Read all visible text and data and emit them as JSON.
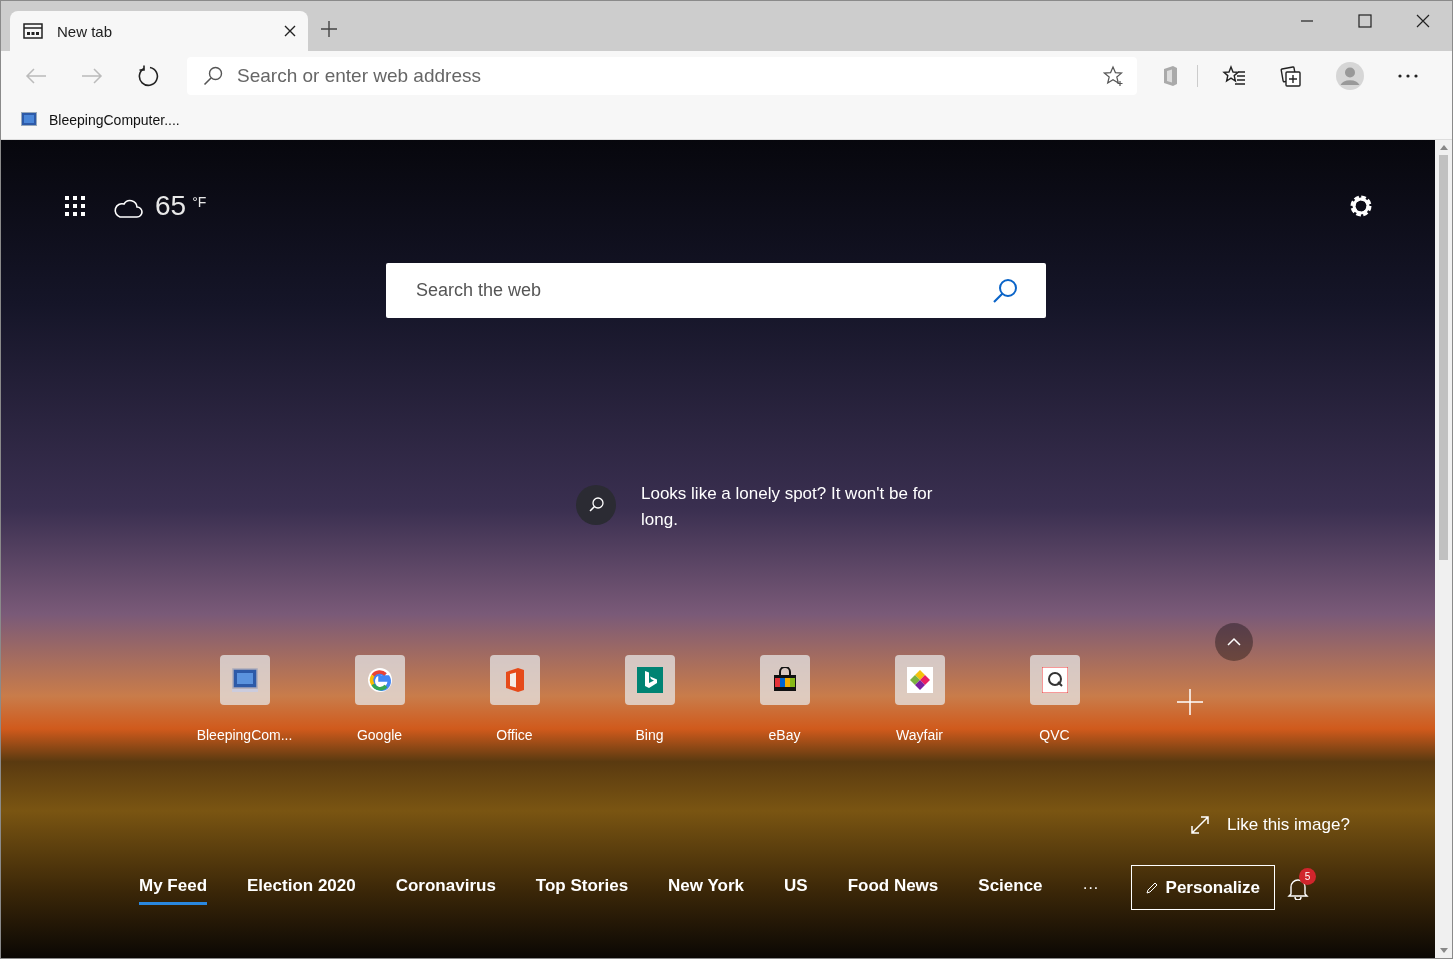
{
  "window": {
    "tab": {
      "title": "New tab",
      "selected": true
    }
  },
  "address_bar": {
    "placeholder": "Search or enter web address"
  },
  "bookmarks": [
    {
      "label": "BleepingComputer...."
    }
  ],
  "weather": {
    "temperature": "65",
    "unit": "°F"
  },
  "search": {
    "placeholder": "Search the web"
  },
  "tip": {
    "text": "Looks like a lonely spot? It won't be for long."
  },
  "top_sites": [
    {
      "label": "BleepingCom..."
    },
    {
      "label": "Google"
    },
    {
      "label": "Office"
    },
    {
      "label": "Bing"
    },
    {
      "label": "eBay"
    },
    {
      "label": "Wayfair"
    },
    {
      "label": "QVC"
    }
  ],
  "image_prompt": "Like this image?",
  "feed_tabs": [
    {
      "label": "My Feed",
      "selected": true
    },
    {
      "label": "Election 2020",
      "selected": false
    },
    {
      "label": "Coronavirus",
      "selected": false
    },
    {
      "label": "Top Stories",
      "selected": false
    },
    {
      "label": "New York",
      "selected": false
    },
    {
      "label": "US",
      "selected": false
    },
    {
      "label": "Food News",
      "selected": false
    },
    {
      "label": "Science",
      "selected": false
    }
  ],
  "more": "···",
  "personalize": "Personalize",
  "notifications": {
    "count": "5"
  }
}
